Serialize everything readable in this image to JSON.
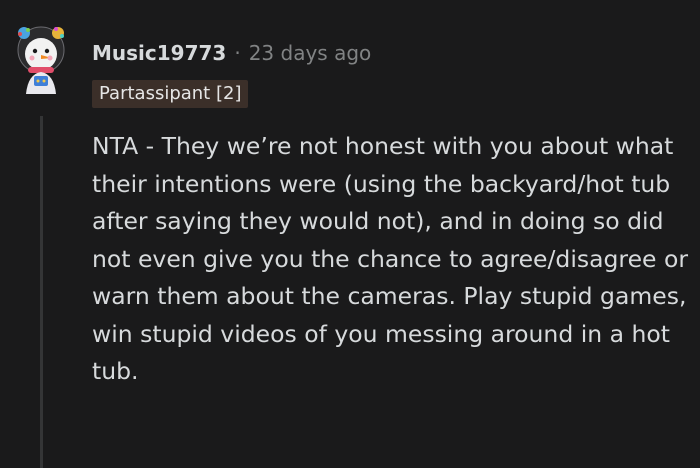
{
  "comment": {
    "username": "Music19773",
    "separator": "·",
    "time": "23 days ago",
    "flair": "Partassipant [2]",
    "body": "NTA - They we’re not honest with you about what their intentions were (using the backyard/hot tub after saying they would not), and in doing so did not even give you the chance to agree/disagree or warn them about the cameras. Play stupid games, win stupid videos of you messing around in a hot tub."
  },
  "colors": {
    "background": "#1a1a1b",
    "text": "#d7dadc",
    "meta_text": "#818384",
    "flair_bg": "#3b2f29",
    "thread_line": "#343536"
  },
  "icons": {
    "avatar": "snowman-avatar-icon"
  }
}
